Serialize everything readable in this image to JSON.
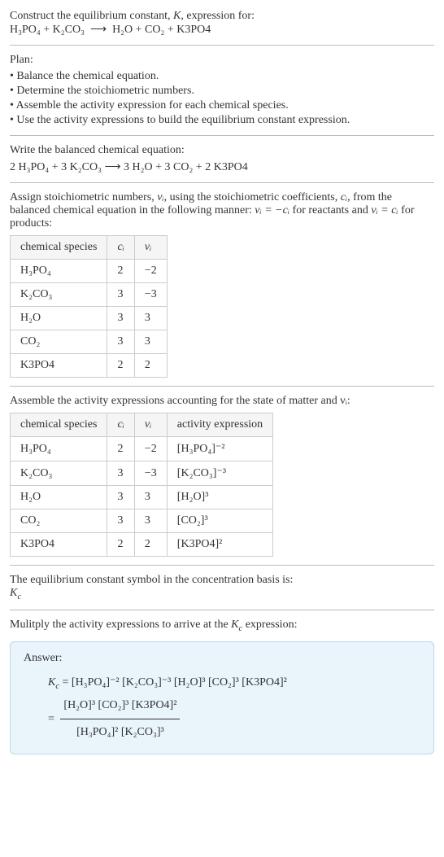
{
  "intro": {
    "line1": "Construct the equilibrium constant, ",
    "K": "K",
    "line1b": ", expression for:",
    "eq_lhs": "H₃PO₄ + K₂CO₃",
    "arrow": "⟶",
    "eq_rhs": "H₂O + CO₂ + K3PO4"
  },
  "plan": {
    "title": "Plan:",
    "items": [
      "• Balance the chemical equation.",
      "• Determine the stoichiometric numbers.",
      "• Assemble the activity expression for each chemical species.",
      "• Use the activity expressions to build the equilibrium constant expression."
    ]
  },
  "balanced": {
    "title": "Write the balanced chemical equation:",
    "eq": "2 H₃PO₄ + 3 K₂CO₃  ⟶  3 H₂O + 3 CO₂ + 2 K3PO4"
  },
  "stoich": {
    "text1": "Assign stoichiometric numbers, ",
    "nu": "νᵢ",
    "text2": ", using the stoichiometric coefficients, ",
    "ci": "cᵢ",
    "text3": ", from the balanced chemical equation in the following manner: ",
    "rel1": "νᵢ = −cᵢ",
    "text4": " for reactants and ",
    "rel2": "νᵢ = cᵢ",
    "text5": " for products:",
    "headers": [
      "chemical species",
      "cᵢ",
      "νᵢ"
    ],
    "rows": [
      {
        "species": "H₃PO₄",
        "c": "2",
        "nu": "−2"
      },
      {
        "species": "K₂CO₃",
        "c": "3",
        "nu": "−3"
      },
      {
        "species": "H₂O",
        "c": "3",
        "nu": "3"
      },
      {
        "species": "CO₂",
        "c": "3",
        "nu": "3"
      },
      {
        "species": "K3PO4",
        "c": "2",
        "nu": "2"
      }
    ]
  },
  "activity": {
    "title": "Assemble the activity expressions accounting for the state of matter and νᵢ:",
    "headers": [
      "chemical species",
      "cᵢ",
      "νᵢ",
      "activity expression"
    ],
    "rows": [
      {
        "species": "H₃PO₄",
        "c": "2",
        "nu": "−2",
        "expr": "[H₃PO₄]⁻²"
      },
      {
        "species": "K₂CO₃",
        "c": "3",
        "nu": "−3",
        "expr": "[K₂CO₃]⁻³"
      },
      {
        "species": "H₂O",
        "c": "3",
        "nu": "3",
        "expr": "[H₂O]³"
      },
      {
        "species": "CO₂",
        "c": "3",
        "nu": "3",
        "expr": "[CO₂]³"
      },
      {
        "species": "K3PO4",
        "c": "2",
        "nu": "2",
        "expr": "[K3PO4]²"
      }
    ]
  },
  "eqconst": {
    "text": "The equilibrium constant symbol in the concentration basis is:",
    "sym": "K",
    "sub": "c"
  },
  "multiply": {
    "text1": "Mulitply the activity expressions to arrive at the ",
    "Kc": "K",
    "sub": "c",
    "text2": " expression:"
  },
  "answer": {
    "label": "Answer:",
    "Kc": "K",
    "sub": "c",
    "eq": " = [H₃PO₄]⁻² [K₂CO₃]⁻³ [H₂O]³ [CO₂]³ [K3PO4]²",
    "eq2prefix": "= ",
    "num": "[H₂O]³ [CO₂]³ [K3PO4]²",
    "den": "[H₃PO₄]² [K₂CO₃]³"
  },
  "chart_data": null
}
